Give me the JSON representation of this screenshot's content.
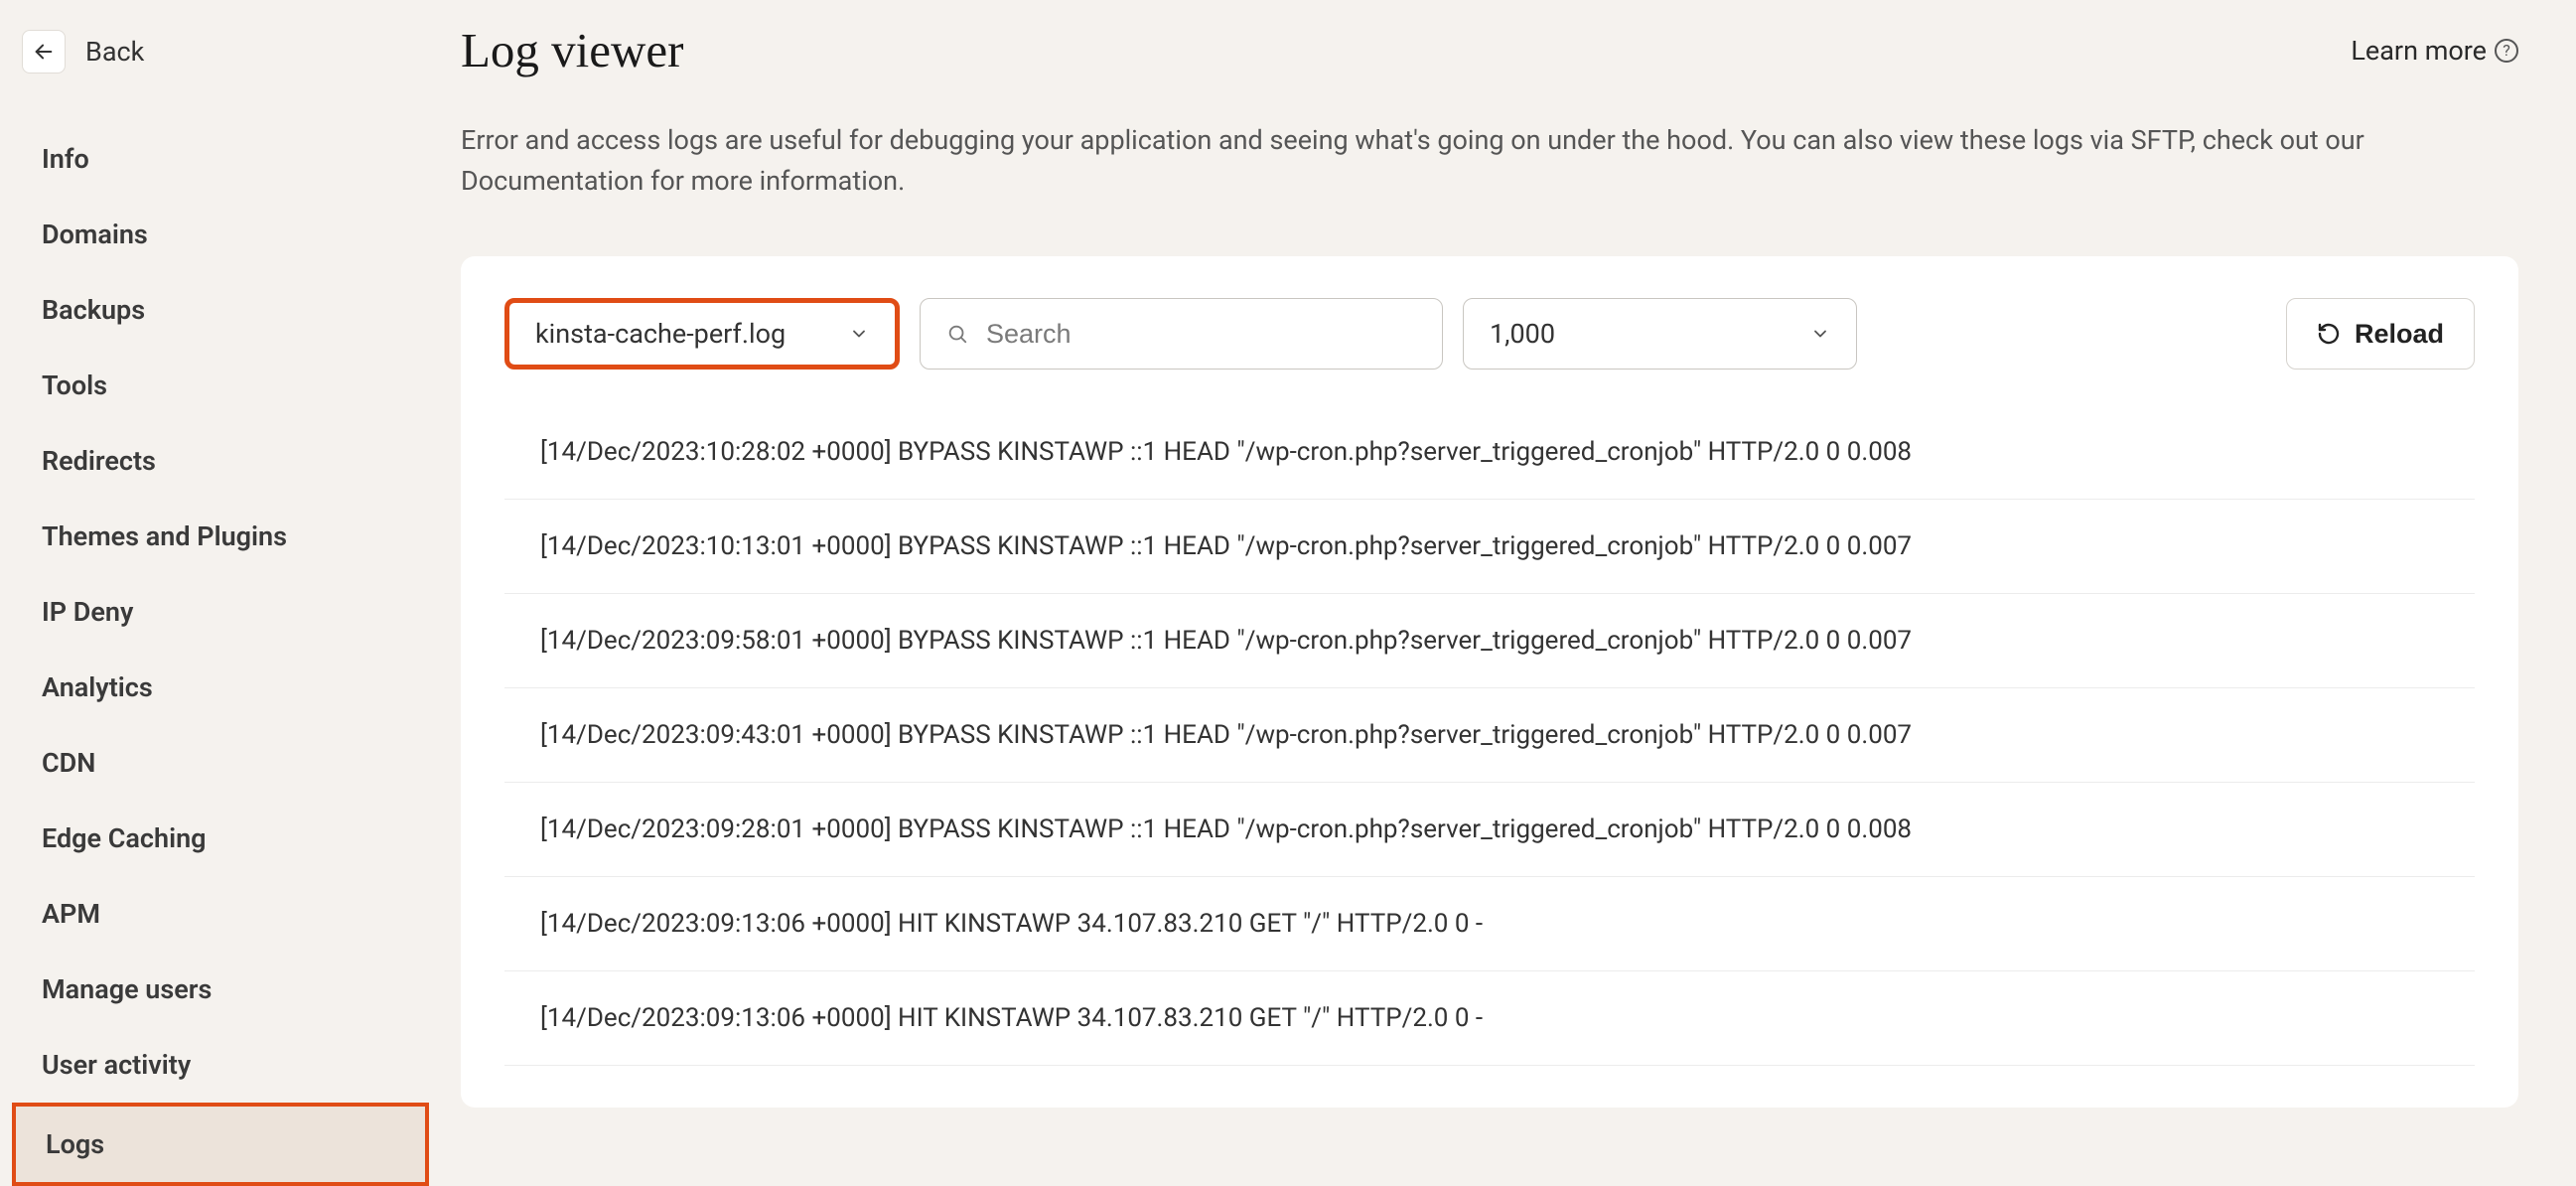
{
  "back": {
    "label": "Back"
  },
  "sidebar": {
    "items": [
      {
        "label": "Info"
      },
      {
        "label": "Domains"
      },
      {
        "label": "Backups"
      },
      {
        "label": "Tools"
      },
      {
        "label": "Redirects"
      },
      {
        "label": "Themes and Plugins"
      },
      {
        "label": "IP Deny"
      },
      {
        "label": "Analytics"
      },
      {
        "label": "CDN"
      },
      {
        "label": "Edge Caching"
      },
      {
        "label": "APM"
      },
      {
        "label": "Manage users"
      },
      {
        "label": "User activity"
      },
      {
        "label": "Logs"
      }
    ],
    "active_index": 13
  },
  "header": {
    "title": "Log viewer",
    "learn_more": "Learn more"
  },
  "description": "Error and access logs are useful for debugging your application and seeing what's going on under the hood. You can also view these logs via SFTP, check out our Documentation for more information.",
  "controls": {
    "file_select": "kinsta-cache-perf.log",
    "search_placeholder": "Search",
    "line_count": "1,000",
    "reload_label": "Reload"
  },
  "logs": [
    "[14/Dec/2023:10:28:02 +0000] BYPASS KINSTAWP ::1 HEAD \"/wp-cron.php?server_triggered_cronjob\" HTTP/2.0 0 0.008",
    "[14/Dec/2023:10:13:01 +0000] BYPASS KINSTAWP ::1 HEAD \"/wp-cron.php?server_triggered_cronjob\" HTTP/2.0 0 0.007",
    "[14/Dec/2023:09:58:01 +0000] BYPASS KINSTAWP ::1 HEAD \"/wp-cron.php?server_triggered_cronjob\" HTTP/2.0 0 0.007",
    "[14/Dec/2023:09:43:01 +0000] BYPASS KINSTAWP ::1 HEAD \"/wp-cron.php?server_triggered_cronjob\" HTTP/2.0 0 0.007",
    "[14/Dec/2023:09:28:01 +0000] BYPASS KINSTAWP ::1 HEAD \"/wp-cron.php?server_triggered_cronjob\" HTTP/2.0 0 0.008",
    "[14/Dec/2023:09:13:06 +0000] HIT KINSTAWP 34.107.83.210 GET \"/\" HTTP/2.0 0 -",
    "[14/Dec/2023:09:13:06 +0000] HIT KINSTAWP 34.107.83.210 GET \"/\" HTTP/2.0 0 -"
  ]
}
